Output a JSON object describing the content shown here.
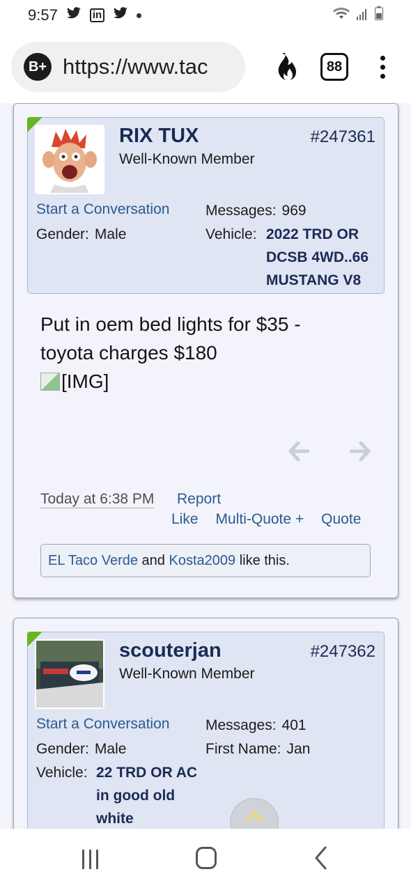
{
  "status_bar": {
    "time": "9:57",
    "icons": [
      "twitter-icon",
      "linkedin-icon",
      "twitter-icon",
      "dot-icon",
      "wifi-icon",
      "signal-icon",
      "battery-icon"
    ]
  },
  "browser": {
    "site_badge": "B+",
    "url": "https://www.tac",
    "tab_count": "88"
  },
  "posts": [
    {
      "username": "RIX TUX",
      "user_title": "Well-Known Member",
      "post_number": "#247361",
      "start_conversation": "Start a Conversation",
      "gender_label": "Gender:",
      "gender": "Male",
      "messages_label": "Messages:",
      "messages": "969",
      "vehicle_label": "Vehicle:",
      "vehicle_lines": [
        "2022 TRD OR",
        "DCSB 4WD..66",
        "MUSTANG V8"
      ],
      "message_line1": "Put in oem bed lights for $35 -",
      "message_line2": "toyota charges $180",
      "image_alt": "[IMG]",
      "date": "Today at 6:38 PM",
      "report": "Report",
      "like": "Like",
      "multi_quote": "Multi-Quote +",
      "quote": "Quote",
      "likers": [
        "EL Taco Verde",
        "Kosta2009"
      ],
      "likes_and": "and",
      "likes_suffix": "like this."
    },
    {
      "username": "scouterjan",
      "user_title": "Well-Known Member",
      "post_number": "#247362",
      "start_conversation": "Start a Conversation",
      "gender_label": "Gender:",
      "gender": "Male",
      "messages_label": "Messages:",
      "messages": "401",
      "first_name_label": "First Name:",
      "first_name": "Jan",
      "vehicle_label": "Vehicle:",
      "vehicle_lines": [
        "22 TRD OR AC",
        "in good old",
        "white"
      ]
    }
  ],
  "colors": {
    "link": "#2b5a90",
    "username": "#1b2a55",
    "userbox_bg": "#e0e5f3",
    "online": "#67b61f"
  }
}
